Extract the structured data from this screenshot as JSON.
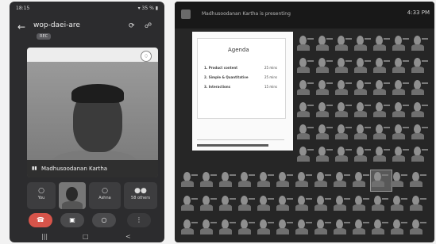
{
  "phone": {
    "status_time": "18:15",
    "status_right": "▾ 35 % ▮",
    "meeting_title": "wop-daei-are",
    "rec_badge": "REC",
    "speaker_name": "Madhusoodanan Kartha",
    "strip": [
      {
        "label": "You",
        "icon": "mic-off-icon"
      },
      {
        "label": "",
        "icon": "speaker-thumbnail"
      },
      {
        "label": "Ashna",
        "icon": "mic-off-icon"
      },
      {
        "label": "58 others",
        "icon": "avatars-icon"
      }
    ],
    "controls": [
      "end-call",
      "camera-off",
      "mic-off",
      "more"
    ]
  },
  "desktop": {
    "meeting_title": "Madhusoodanan Kartha is presenting",
    "clock": "4:33 PM",
    "slide": {
      "title": "Agenda",
      "items": [
        {
          "text": "1. Product content",
          "time": "25 mins"
        },
        {
          "text": "2. Simple & Quantitative",
          "time": "25 mins"
        },
        {
          "text": "3. Interactions",
          "time": "15 mins"
        }
      ]
    }
  },
  "colors": {
    "phone_bg": "#2c2c2e",
    "desktop_bg": "#262626",
    "end_call": "#d6544a"
  }
}
